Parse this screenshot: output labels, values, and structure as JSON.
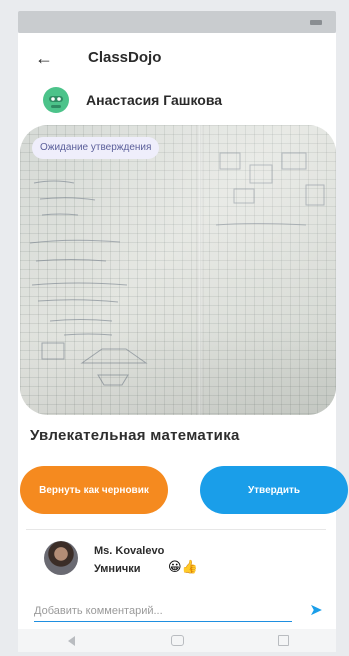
{
  "status_bar": {
    "left_text": "",
    "right_text": ""
  },
  "header": {
    "back_icon": "arrow-left-icon",
    "app_title": "ClassDojo"
  },
  "student": {
    "avatar_icon": "monster-avatar-icon",
    "avatar_color": "#4cc38a",
    "name": "Анастасия Гашкова"
  },
  "post": {
    "status_badge": "Ожидание утверждения",
    "title": "Увлекательная математика"
  },
  "actions": {
    "return_draft_label": "Вернуть как черновик",
    "approve_label": "Утвердить",
    "return_draft_color": "#f58a1f",
    "approve_color": "#1a9ee9"
  },
  "comment": {
    "author": "Ms. Kovalevo",
    "time": "",
    "text": "Умнички",
    "emojis": "😀👍"
  },
  "comment_input": {
    "placeholder": "Добавить комментарий...",
    "send_icon": "send-icon"
  },
  "navigation": {
    "back_icon": "nav-back-icon",
    "home_icon": "nav-home-icon",
    "recent_icon": "nav-recent-icon"
  }
}
